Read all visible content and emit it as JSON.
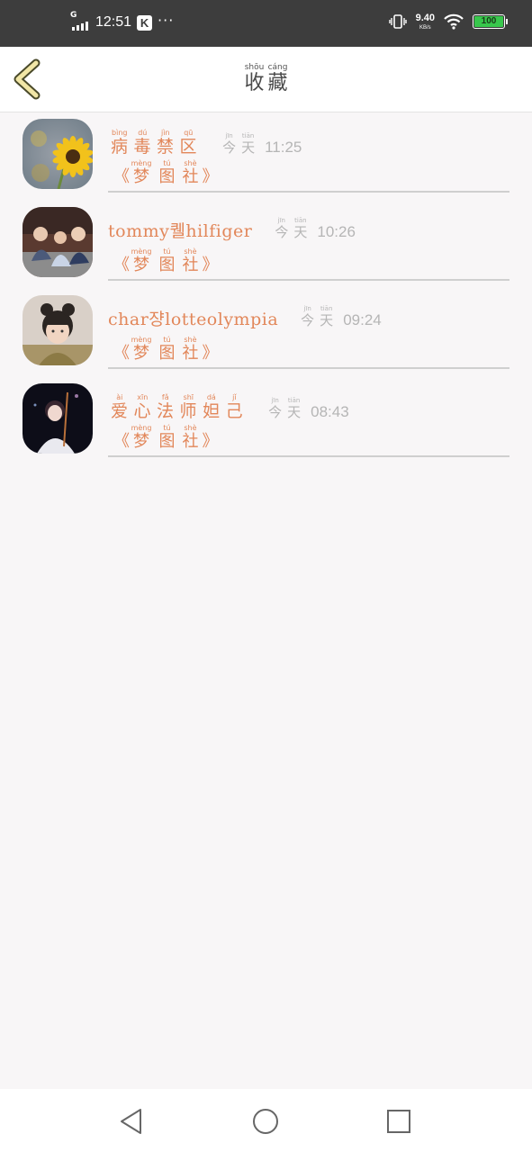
{
  "status_bar": {
    "network": "G",
    "time": "12:51",
    "app_badge": "K",
    "more": "···",
    "net_speed_value": "9.40",
    "net_speed_unit": "KB/s",
    "battery_level": "100",
    "battery_color": "#38c74c"
  },
  "header": {
    "title_chars": [
      {
        "char": "收",
        "pinyin": "shōu"
      },
      {
        "char": "藏",
        "pinyin": "cáng"
      }
    ]
  },
  "colors": {
    "accent": "#e2875a",
    "muted": "#b5b5b5",
    "back_arrow_fill": "#f1e6a6",
    "back_arrow_stroke": "#4a4a2a"
  },
  "items": [
    {
      "avatar": "sunflower-photo",
      "name_segments": [
        {
          "char": "病",
          "pinyin": "bìng"
        },
        {
          "char": "毒",
          "pinyin": "dú"
        },
        {
          "char": "禁",
          "pinyin": "jìn"
        },
        {
          "char": "区",
          "pinyin": "qū"
        }
      ],
      "day": [
        {
          "char": "今",
          "pinyin": "jīn"
        },
        {
          "char": "天",
          "pinyin": "tiān"
        }
      ],
      "time": "11:25",
      "source": {
        "open": "《",
        "chars": [
          {
            "char": "梦",
            "pinyin": "mèng"
          },
          {
            "char": "图",
            "pinyin": "tú"
          },
          {
            "char": "社",
            "pinyin": "shè"
          }
        ],
        "close": "》"
      }
    },
    {
      "avatar": "group-photo",
      "name_segments": [
        {
          "text": "tommy"
        },
        {
          "text": "퀠"
        },
        {
          "text": "hilfiger"
        }
      ],
      "day": [
        {
          "char": "今",
          "pinyin": "jīn"
        },
        {
          "char": "天",
          "pinyin": "tiān"
        }
      ],
      "time": "10:26",
      "source": {
        "open": "《",
        "chars": [
          {
            "char": "梦",
            "pinyin": "mèng"
          },
          {
            "char": "图",
            "pinyin": "tú"
          },
          {
            "char": "社",
            "pinyin": "shè"
          }
        ],
        "close": "》"
      }
    },
    {
      "avatar": "child-photo",
      "name_segments": [
        {
          "text": "char"
        },
        {
          "text": "쟝"
        },
        {
          "text": "lotteolympia"
        }
      ],
      "day": [
        {
          "char": "今",
          "pinyin": "jīn"
        },
        {
          "char": "天",
          "pinyin": "tiān"
        }
      ],
      "time": "09:24",
      "source": {
        "open": "《",
        "chars": [
          {
            "char": "梦",
            "pinyin": "mèng"
          },
          {
            "char": "图",
            "pinyin": "tú"
          },
          {
            "char": "社",
            "pinyin": "shè"
          }
        ],
        "close": "》"
      }
    },
    {
      "avatar": "violin-girl-photo",
      "name_segments": [
        {
          "char": "爱",
          "pinyin": "ài"
        },
        {
          "char": "心",
          "pinyin": "xīn"
        },
        {
          "char": "法",
          "pinyin": "fǎ"
        },
        {
          "char": "师",
          "pinyin": "shī"
        },
        {
          "char": "妲",
          "pinyin": "dá"
        },
        {
          "char": "己",
          "pinyin": "jǐ"
        }
      ],
      "day": [
        {
          "char": "今",
          "pinyin": "jīn"
        },
        {
          "char": "天",
          "pinyin": "tiān"
        }
      ],
      "time": "08:43",
      "source": {
        "open": "《",
        "chars": [
          {
            "char": "梦",
            "pinyin": "mèng"
          },
          {
            "char": "图",
            "pinyin": "tú"
          },
          {
            "char": "社",
            "pinyin": "shè"
          }
        ],
        "close": "》"
      }
    }
  ],
  "nav": {
    "back_icon": "triangle-back-icon",
    "home_icon": "circle-home-icon",
    "recents_icon": "square-recents-icon"
  }
}
